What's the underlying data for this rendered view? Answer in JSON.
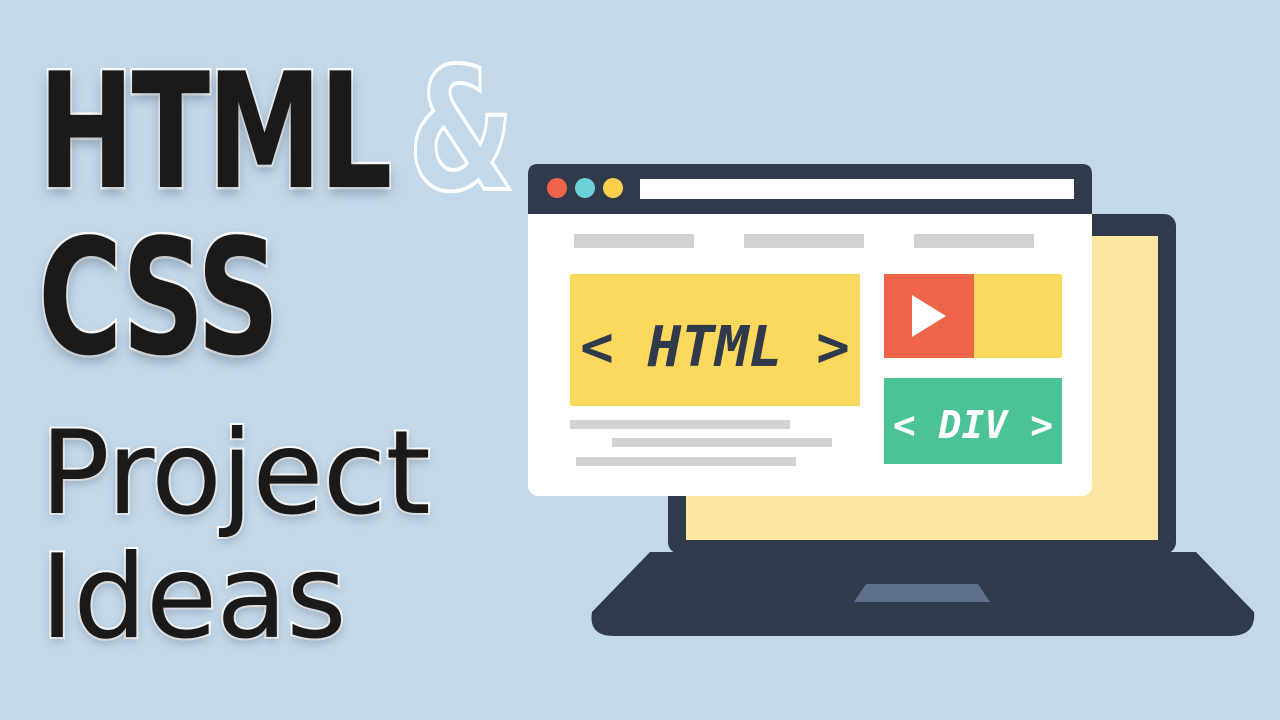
{
  "headline": {
    "line1": "HTML",
    "ampersand": "&",
    "line2": "CSS",
    "line3": "Project",
    "line4": "Ideas"
  },
  "illustration": {
    "html_tag_label": "< HTML >",
    "div_tag_label": "< DIV >",
    "window_dots": [
      "red-dot",
      "cyan-dot",
      "yellow-dot"
    ]
  },
  "colors": {
    "background": "#c3d9ea",
    "laptop_body": "#2f3a4d",
    "laptop_screen": "#fbe7a0",
    "window_bar": "#2f3a4d",
    "window_bg": "#ffffff",
    "yellow_block": "#fcd85c",
    "play_red": "#f0654a",
    "div_green": "#4cc395",
    "placeholder_gray": "#d3d1d4",
    "dot_red": "#f0654a",
    "dot_cyan": "#6dcfd8",
    "dot_yellow": "#f7cf4c",
    "touchpad": "#5d7088"
  }
}
